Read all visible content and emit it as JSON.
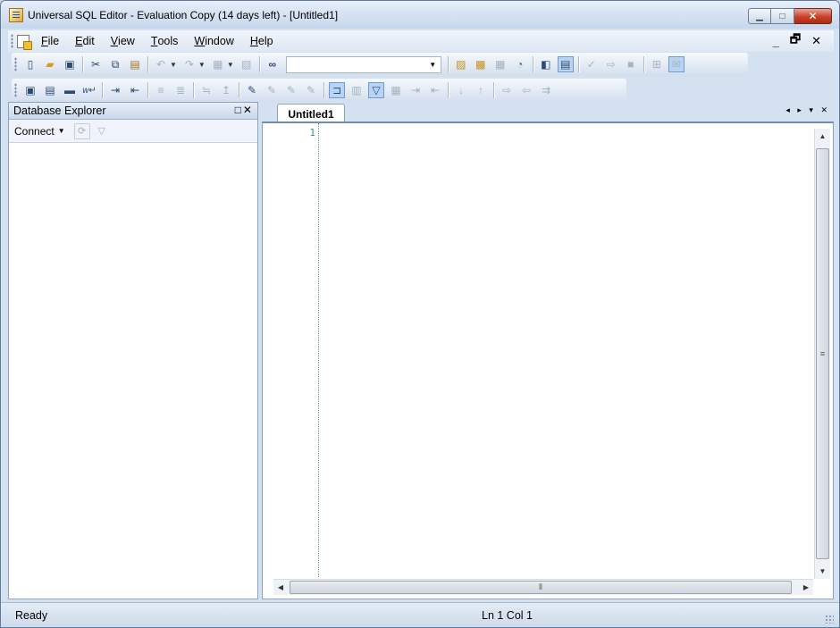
{
  "window": {
    "title": "Universal SQL Editor - Evaluation Copy (14 days left) - [Untitled1]",
    "caption_minimize": "▁",
    "caption_maximize": "□",
    "caption_close": "✕"
  },
  "menu": {
    "items": [
      {
        "key": "F",
        "rest": "ile"
      },
      {
        "key": "E",
        "rest": "dit"
      },
      {
        "key": "V",
        "rest": "iew"
      },
      {
        "key": "T",
        "rest": "ools"
      },
      {
        "key": "W",
        "rest": "indow"
      },
      {
        "key": "H",
        "rest": "elp"
      }
    ],
    "mdi_minimize": "_",
    "mdi_restore": "🗗",
    "mdi_close": "✕"
  },
  "toolbar1": {
    "search_value": ""
  },
  "database_explorer": {
    "title": "Database Explorer",
    "controls": "□✕",
    "connect_label": "Connect"
  },
  "editor": {
    "tab_label": "Untitled1",
    "line_number": "1",
    "tab_nav": "◂ ▸ ▾ ✕"
  },
  "status": {
    "state": "Ready",
    "position": "Ln 1  Col 1"
  },
  "colors": {
    "accent": "#6f8db5",
    "close_button": "#c8412a",
    "gutter_text": "#3c8c8c"
  }
}
